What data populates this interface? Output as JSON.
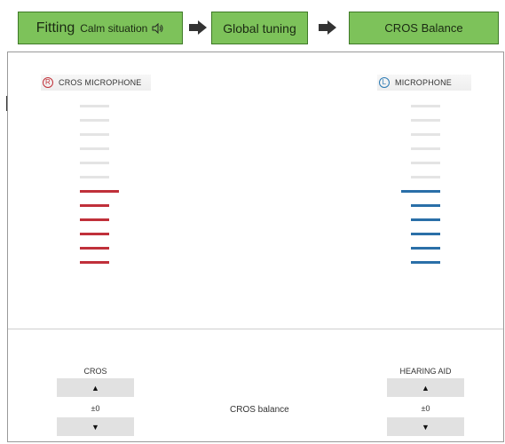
{
  "workflow": {
    "step1": {
      "label": "Fitting",
      "sublabel": "Calm situation"
    },
    "step2": {
      "label": "Global tuning"
    },
    "step3": {
      "label": "CROS Balance"
    }
  },
  "left_mic": {
    "badge": "R",
    "label": "CROS MICROPHONE",
    "color": "#c0303a",
    "active_bars": 6,
    "total_bars": 12
  },
  "right_mic": {
    "badge": "L",
    "label": "MICROPHONE",
    "color": "#2a6fa8",
    "active_bars": 6,
    "total_bars": 12
  },
  "controls": {
    "cros": {
      "label": "CROS",
      "up": "▲",
      "value": "±0",
      "down": "▼"
    },
    "balance_label": "CROS balance",
    "hearing_aid": {
      "label": "HEARING AID",
      "up": "▲",
      "value": "±0",
      "down": "▼"
    }
  },
  "colors": {
    "step_green": "#7dc25a",
    "inactive_bar": "#e4e4e4"
  }
}
